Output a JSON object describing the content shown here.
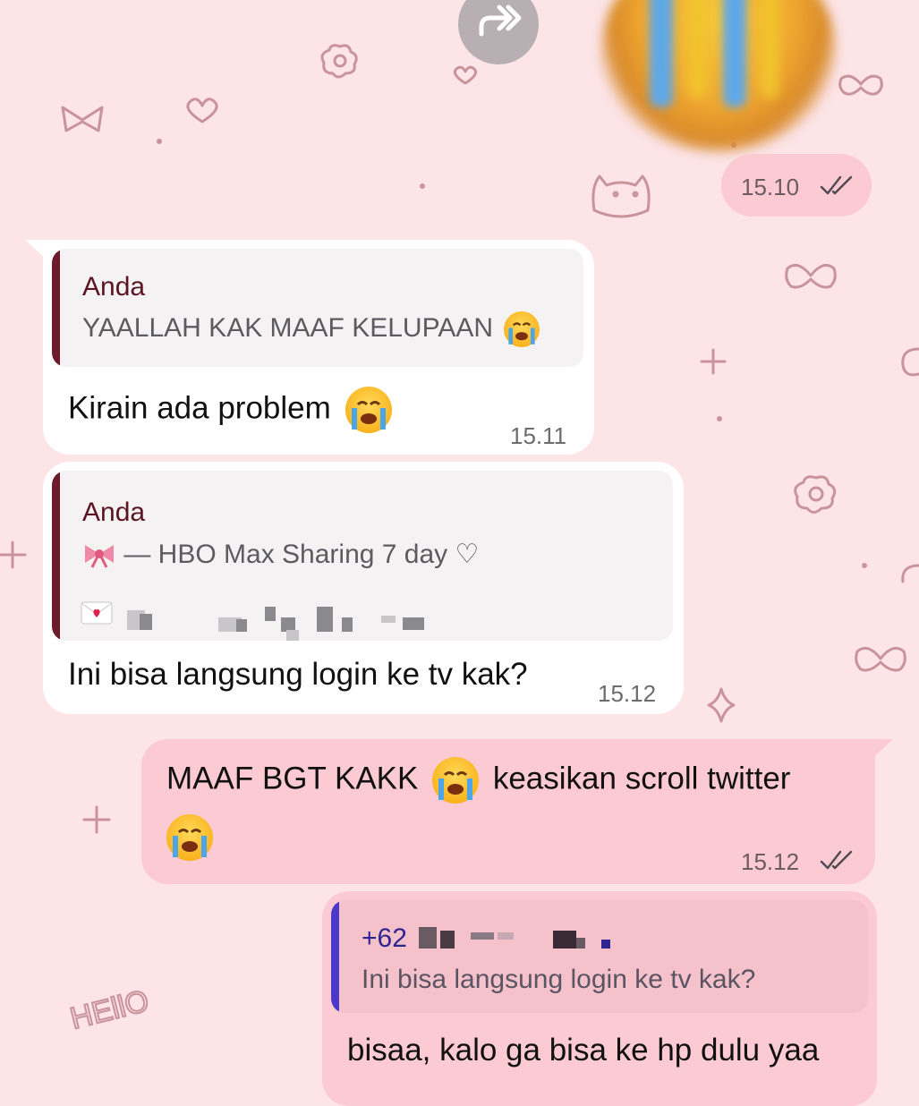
{
  "colors": {
    "background": "#fce4e7",
    "incoming_bubble": "#ffffff",
    "outgoing_bubble": "#fccad3",
    "quote_bar_incoming": "#6d1a2c",
    "quote_bar_outgoing": "#4b39c9",
    "doodle": "#c8939b"
  },
  "icons": {
    "forward": "forward-arrow-icon",
    "read_receipt": "double-check-icon",
    "emoji": "loudly-crying-face-emoji",
    "ribbon": "ribbon-emoji",
    "envelope": "love-letter-emoji"
  },
  "top_message": {
    "time": "15.10"
  },
  "messages": [
    {
      "quote_name": "Anda",
      "quote_text": "YAALLAH KAK MAAF KELUPAAN",
      "text": "Kirain ada problem",
      "time": "15.11"
    },
    {
      "quote_name": "Anda",
      "quote_line1": "— HBO Max Sharing 7 day ♡",
      "text": "Ini bisa langsung login ke tv kak?",
      "time": "15.12"
    },
    {
      "text_part1": "MAAF BGT KAKK",
      "text_part2": "keasikan scroll twitter",
      "time": "15.12"
    },
    {
      "quote_name": "+62",
      "quote_text": "Ini bisa langsung login ke tv kak?",
      "text": "bisaa, kalo ga bisa ke hp dulu yaa"
    }
  ],
  "doodle_texts": {
    "hello": "HEllO"
  }
}
